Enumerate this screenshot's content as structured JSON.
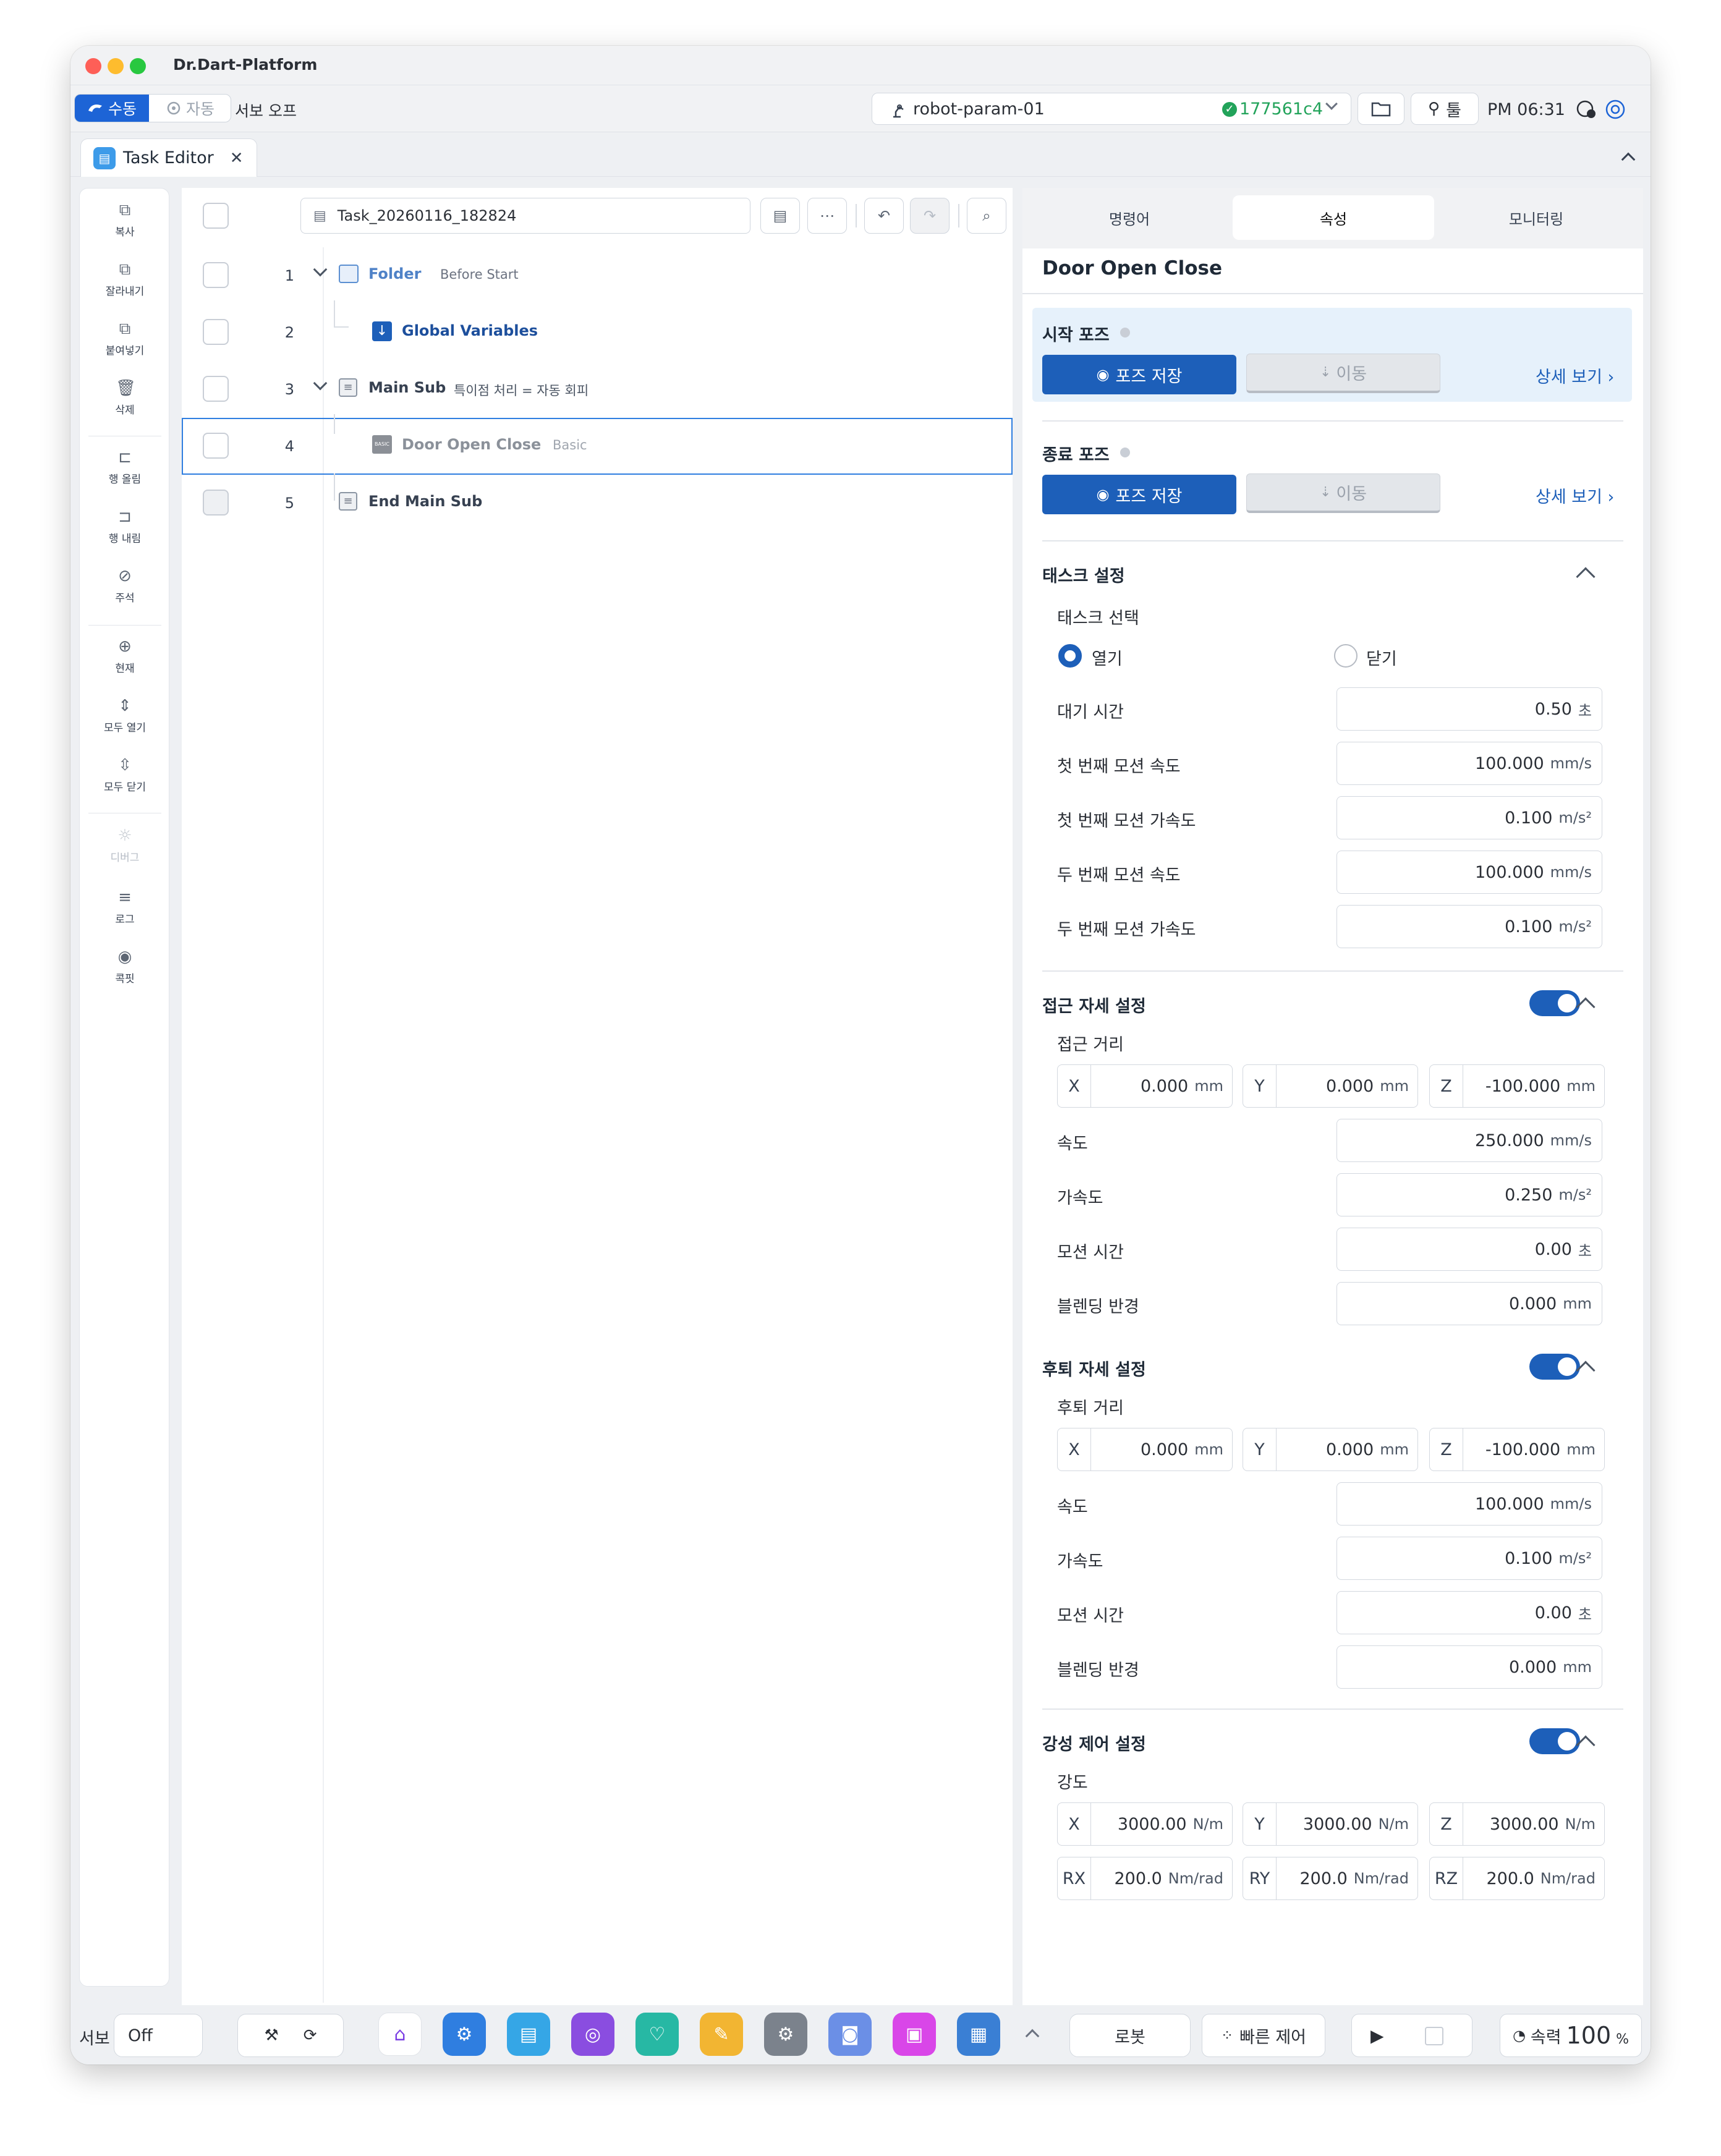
{
  "window": {
    "title": "Dr.Dart-Platform"
  },
  "topbar": {
    "mode_manual": "수동",
    "mode_auto": "자동",
    "servo_status": "서보 오프",
    "robot_name": "robot-param-01",
    "version": "177561c4",
    "tools_label": "툴",
    "time": "PM 06:31"
  },
  "tab": {
    "label": "Task Editor"
  },
  "sidebar": {
    "items": [
      {
        "label": "복사",
        "icon": "copy-icon"
      },
      {
        "label": "잘라내기",
        "icon": "cut-icon"
      },
      {
        "label": "붙여넣기",
        "icon": "paste-icon"
      },
      {
        "label": "삭제",
        "icon": "trash-icon"
      },
      {
        "label": "행 올림",
        "icon": "indent-icon"
      },
      {
        "label": "행 내림",
        "icon": "outdent-icon"
      },
      {
        "label": "주석",
        "icon": "comment-icon"
      },
      {
        "label": "현재",
        "icon": "target-icon"
      },
      {
        "label": "모두 열기",
        "icon": "expand-all-icon"
      },
      {
        "label": "모두 닫기",
        "icon": "collapse-all-icon"
      },
      {
        "label": "디버그",
        "icon": "debug-icon"
      },
      {
        "label": "로그",
        "icon": "log-icon"
      },
      {
        "label": "콕핏",
        "icon": "cockpit-icon"
      }
    ]
  },
  "editor": {
    "filename": "Task_20260116_182824",
    "rows": [
      {
        "num": "1",
        "name": "Folder",
        "desc": "Before Start"
      },
      {
        "num": "2",
        "name": "Global Variables",
        "desc": ""
      },
      {
        "num": "3",
        "name": "Main Sub",
        "desc": "특이점 처리 = 자동 회피"
      },
      {
        "num": "4",
        "name": "Door Open Close",
        "desc": "Basic"
      },
      {
        "num": "5",
        "name": "End Main Sub",
        "desc": ""
      }
    ],
    "basic_badge": "BASIC"
  },
  "props": {
    "tabs": [
      "명령어",
      "속성",
      "모니터링"
    ],
    "title": "Door Open Close",
    "start_pose": {
      "label": "시작 포즈",
      "save": "포즈 저장",
      "move": "이동",
      "detail": "상세 보기"
    },
    "end_pose": {
      "label": "종료 포즈",
      "save": "포즈 저장",
      "move": "이동",
      "detail": "상세 보기"
    },
    "task": {
      "header": "태스크 설정",
      "select_label": "태스크 선택",
      "open": "열기",
      "close": "닫기",
      "wait_label": "대기 시간",
      "wait_value": "0.50",
      "wait_unit": "초",
      "v1_label": "첫 번째 모션 속도",
      "v1_value": "100.000",
      "v1_unit": "mm/s",
      "a1_label": "첫 번째 모션 가속도",
      "a1_value": "0.100",
      "a1_unit": "m/s²",
      "v2_label": "두 번째 모션 속도",
      "v2_value": "100.000",
      "v2_unit": "mm/s",
      "a2_label": "두 번째 모션 가속도",
      "a2_value": "0.100",
      "a2_unit": "m/s²"
    },
    "approach": {
      "header": "접근 자세 설정",
      "dist_label": "접근 거리",
      "x": "0.000",
      "y": "0.000",
      "z": "-100.000",
      "dist_unit": "mm",
      "speed_label": "속도",
      "speed": "250.000",
      "speed_unit": "mm/s",
      "acc_label": "가속도",
      "acc": "0.250",
      "acc_unit": "m/s²",
      "time_label": "모션 시간",
      "time": "0.00",
      "time_unit": "초",
      "blend_label": "블렌딩 반경",
      "blend": "0.000",
      "blend_unit": "mm"
    },
    "retreat": {
      "header": "후퇴 자세 설정",
      "dist_label": "후퇴 거리",
      "x": "0.000",
      "y": "0.000",
      "z": "-100.000",
      "dist_unit": "mm",
      "speed_label": "속도",
      "speed": "100.000",
      "speed_unit": "mm/s",
      "acc_label": "가속도",
      "acc": "0.100",
      "acc_unit": "m/s²",
      "time_label": "모션 시간",
      "time": "0.00",
      "time_unit": "초",
      "blend_label": "블렌딩 반경",
      "blend": "0.000",
      "blend_unit": "mm"
    },
    "stiffness": {
      "header": "강성 제어 설정",
      "label": "강도",
      "x": "3000.00",
      "y": "3000.00",
      "z": "3000.00",
      "lin_unit": "N/m",
      "rx": "200.0",
      "ry": "200.0",
      "rz": "200.0",
      "rot_unit": "Nm/rad"
    },
    "axes": {
      "x": "X",
      "y": "Y",
      "z": "Z",
      "rx": "RX",
      "ry": "RY",
      "rz": "RZ"
    }
  },
  "bottombar": {
    "servo_label": "서보",
    "servo_value": "Off",
    "robot_label": "로봇",
    "quick_control": "빠른 제어",
    "speed_label": "속력",
    "speed_value": "100",
    "speed_unit": "%"
  },
  "colors": {
    "accent": "#1d5fb9",
    "success": "#22a35a",
    "selection": "#2f7ee0"
  }
}
